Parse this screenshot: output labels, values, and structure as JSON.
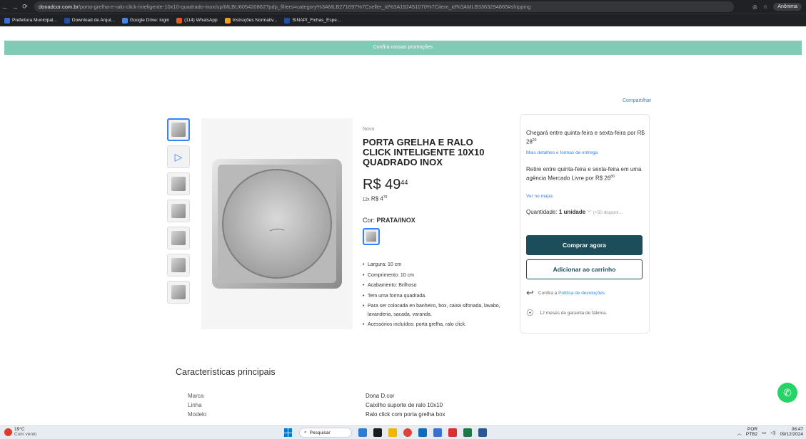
{
  "browser": {
    "url_domain": "donadcor.com.br",
    "url_path": "/porta-grelha-e-ralo-click-inteligente-10x10-quadrado-inox/up/MLBU605420862?pdp_filters=category%3AMLB271697%7Cseller_id%3A182451070%7Citem_id%3AMLB3363294865#shipping",
    "profile_label": "Anônima",
    "bookmarks": [
      {
        "label": "Prefeitura Municipal...",
        "color": "#3b6fd8"
      },
      {
        "label": "Download de Arqui...",
        "color": "#1f4fa8"
      },
      {
        "label": "Google Drive: login",
        "color": "#4285f4"
      },
      {
        "label": "(114) WhatsApp",
        "color": "#e55a1e"
      },
      {
        "label": "Instruções Normativ...",
        "color": "#f0a020"
      },
      {
        "label": "SINAPI_Fichas_Espe...",
        "color": "#1f4fa8"
      }
    ]
  },
  "promo": "Confira nossas promoções",
  "share": "Compartilhar",
  "product": {
    "condition": "Novo",
    "title": "PORTA GRELHA E RALO CLICK INTELIGENTE 10X10 QUADRADO INOX",
    "price_int": "R$ 49",
    "price_cents": "44",
    "installments_prefix": "12x",
    "installments_value": "R$ 4",
    "installments_cents": "79",
    "color_label": "Cor:",
    "color_value": "PRATA/INOX",
    "specs": [
      "Largura: 10 cm",
      "Comprimento: 10 cm",
      "Acabamento: Brilhoso",
      "Tem uma forma quadrada.",
      "Para ser colocada en banheiro, box, caixa sifonada, lavabo, lavanderia, sacada, varanda.",
      "Acessórios incluídos: porta grelha, ralo click."
    ]
  },
  "buybox": {
    "delivery": "Chegará entre quinta-feira e sexta-feira por R$ 28",
    "delivery_cents": "20",
    "delivery_link": "Mais detalhes e formas de entrega",
    "pickup": "Retire entre quinta-feira e sexta-feira em uma agência Mercado Livre por R$ 26",
    "pickup_cents": "80",
    "pickup_link": "Ver no mapa",
    "qty_label": "Quantidade:",
    "qty_value": "1 unidade",
    "qty_avail": "(+50 disponí...",
    "buy_now": "Comprar agora",
    "add_cart": "Adicionar ao carrinho",
    "return_prefix": "Confira a",
    "return_link": "Política de devoluções",
    "warranty": "12 meses de garantia de fábrica."
  },
  "characteristics": {
    "title": "Características principais",
    "rows": [
      {
        "k": "Marca",
        "v": "Dona D.cor"
      },
      {
        "k": "Linha",
        "v": "Caixilho suporte de ralo 10x10"
      },
      {
        "k": "Modelo",
        "v": "Ralo click com porta grelha box"
      }
    ]
  },
  "taskbar": {
    "temp": "19°C",
    "weather": "Com vento",
    "search": "Pesquisar",
    "lang": "POR",
    "lang2": "PTB2",
    "time": "08:47",
    "date": "09/12/2024"
  }
}
